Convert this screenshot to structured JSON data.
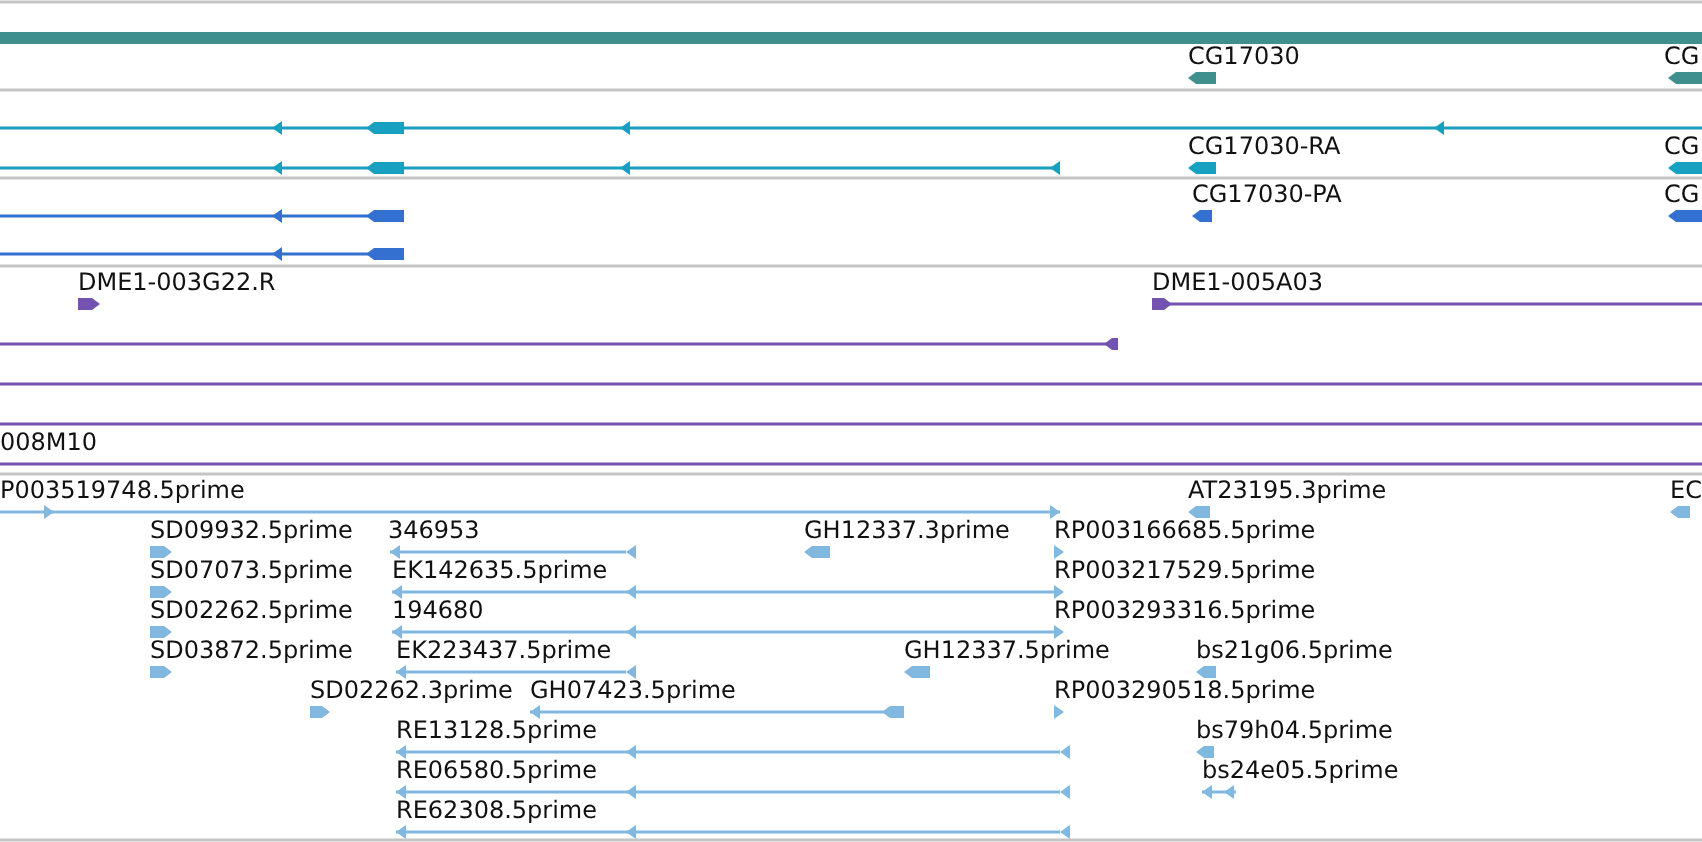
{
  "tracks": [
    {
      "kind": "gene",
      "color": "#3f8f8f",
      "features": [
        {
          "label": "CG17030",
          "reverse": true
        },
        {
          "label": "CG",
          "reverse": true
        }
      ]
    },
    {
      "kind": "transcript",
      "color": "#17a0c0",
      "features": [
        {
          "reverse": true
        },
        {
          "reverse": true
        },
        {
          "label": "CG17030-RA",
          "reverse": true
        },
        {
          "label": "CG",
          "reverse": true
        }
      ]
    },
    {
      "kind": "protein",
      "color": "#3370d0",
      "features": [
        {
          "reverse": true
        },
        {
          "reverse": true
        },
        {
          "label": "CG17030-PA",
          "reverse": true
        },
        {
          "label": "CG",
          "reverse": true
        }
      ]
    },
    {
      "kind": "clone",
      "color": "#7352b0",
      "features": [
        {
          "kind": "glyph",
          "label": "DME1-003G22.R",
          "reverse": false
        },
        {
          "kind": "glyph",
          "reverse": true
        },
        {
          "kind": "glyph",
          "label": "DME1-005A03",
          "reverse": false
        },
        {
          "kind": "span"
        },
        {
          "kind": "span"
        },
        {
          "kind": "span",
          "label": "008M10"
        }
      ]
    },
    {
      "kind": "est",
      "color": "#80b8e0",
      "features": [
        {
          "label": "P003519748.5prime",
          "reverse": false
        },
        {
          "label": "AT23195.3prime",
          "reverse": true
        },
        {
          "label": "EC",
          "reverse": true
        },
        {
          "label": "SD09932.5prime",
          "reverse": false
        },
        {
          "label": "346953",
          "reverse": true
        },
        {
          "label": "GH12337.3prime",
          "reverse": true
        },
        {
          "label": "RP003166685.5prime",
          "reverse": false
        },
        {
          "label": "SD07073.5prime",
          "reverse": false
        },
        {
          "label": "EK142635.5prime",
          "reverse": true
        },
        {
          "label": "RP003217529.5prime",
          "reverse": false
        },
        {
          "label": "SD02262.5prime",
          "reverse": false
        },
        {
          "label": "194680",
          "reverse": true
        },
        {
          "label": "RP003293316.5prime",
          "reverse": false
        },
        {
          "label": "SD03872.5prime",
          "reverse": false
        },
        {
          "label": "EK223437.5prime",
          "reverse": true
        },
        {
          "label": "GH12337.5prime",
          "reverse": true
        },
        {
          "label": "bs21g06.5prime",
          "reverse": true
        },
        {
          "label": "SD02262.3prime",
          "reverse": false
        },
        {
          "label": "GH07423.5prime",
          "reverse": true
        },
        {
          "label": "RP003290518.5prime",
          "reverse": false
        },
        {
          "label": "RE13128.5prime",
          "reverse": true
        },
        {
          "label": "bs79h04.5prime",
          "reverse": true
        },
        {
          "label": "RE06580.5prime",
          "reverse": true
        },
        {
          "label": "bs24e05.5prime",
          "reverse": true
        },
        {
          "label": "RE62308.5prime",
          "reverse": true
        }
      ]
    }
  ]
}
